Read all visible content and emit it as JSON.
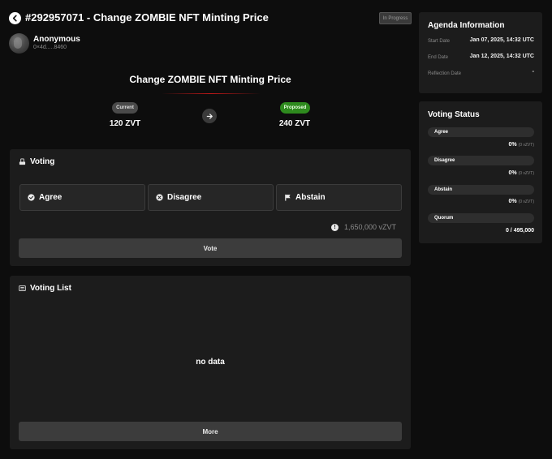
{
  "header": {
    "title": "#292957071 - Change ZOMBIE NFT Minting Price",
    "status": "In Progress",
    "author_name": "Anonymous",
    "author_address": "0×4d.....8460"
  },
  "proposal": {
    "title": "Change ZOMBIE NFT Minting Price",
    "current_label": "Current",
    "current_value": "120 ZVT",
    "proposed_label": "Proposed",
    "proposed_value": "240 ZVT"
  },
  "voting": {
    "heading": "Voting",
    "choices": [
      "Agree",
      "Disagree",
      "Abstain"
    ],
    "voting_power": "1,650,000 vZVT",
    "vote_button": "Vote"
  },
  "voting_list": {
    "heading": "Voting List",
    "empty_text": "no data",
    "more_button": "More"
  },
  "agenda": {
    "heading": "Agenda Information",
    "rows": [
      {
        "label": "Start Date",
        "value": "Jan 07, 2025, 14:32 UTC"
      },
      {
        "label": "End Date",
        "value": "Jan 12, 2025, 14:32 UTC"
      },
      {
        "label": "Reflection Date",
        "value": "-"
      }
    ]
  },
  "voting_status": {
    "heading": "Voting Status",
    "items": [
      {
        "label": "Agree",
        "percent": "0%",
        "detail": "(0 vZVT)",
        "level": 0
      },
      {
        "label": "Disagree",
        "percent": "0%",
        "detail": "(0 vZVT)",
        "level": 0
      },
      {
        "label": "Abstain",
        "percent": "0%",
        "detail": "(0 vZVT)",
        "level": 0
      }
    ],
    "quorum_label": "Quorum",
    "quorum_value": "0 / 495,000",
    "quorum_level": 0
  },
  "colors": {
    "background": "#0d0d0d",
    "card": "#1c1c1c",
    "proposed_badge": "#2e8a1e",
    "accent_underline": "#c01818"
  },
  "icons": [
    "back-icon",
    "arrow-right-icon",
    "ballot-icon",
    "check-circle-icon",
    "x-circle-icon",
    "flag-icon",
    "info-icon",
    "list-icon"
  ]
}
